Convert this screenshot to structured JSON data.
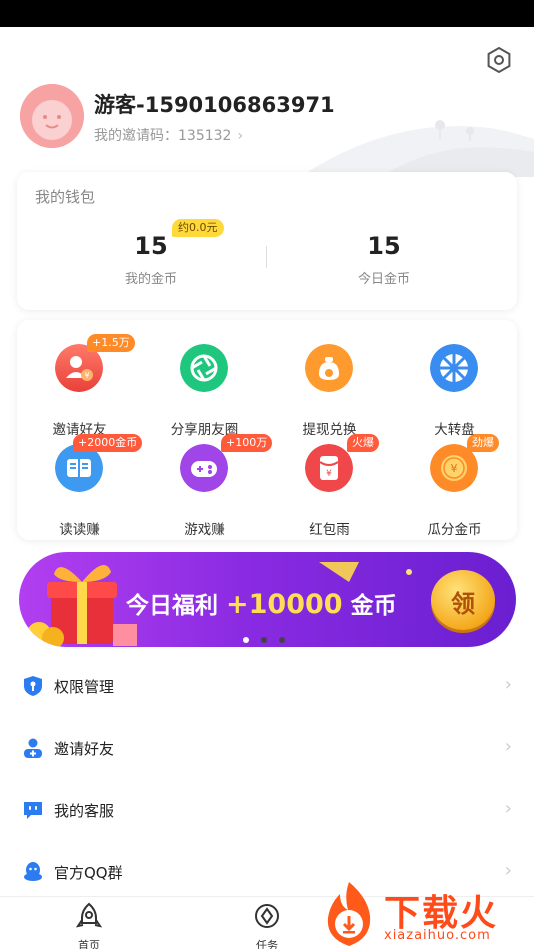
{
  "profile": {
    "username": "游客-1590106863971",
    "invite_code_label": "我的邀请码：135132",
    "chevron": "›"
  },
  "wallet": {
    "title": "我的钱包",
    "approx_badge": "约0.0元",
    "my_coins_value": "15",
    "my_coins_label": "我的金币",
    "today_coins_value": "15",
    "today_coins_label": "今日金币"
  },
  "grid": [
    {
      "label": "邀请好友",
      "badge": "+1.5万",
      "icon": "invite-friend-icon",
      "color": "#f25a4a"
    },
    {
      "label": "分享朋友圈",
      "badge": "",
      "icon": "moments-aperture-icon",
      "color": "#1ec77d"
    },
    {
      "label": "提现兑换",
      "badge": "",
      "icon": "money-bag-icon",
      "color": "#ff9a2e"
    },
    {
      "label": "大转盘",
      "badge": "",
      "icon": "wheel-icon",
      "color": "#3a8df0"
    },
    {
      "label": "读读赚",
      "badge": "+2000金币",
      "icon": "book-icon",
      "color": "#3d9af0"
    },
    {
      "label": "游戏赚",
      "badge": "+100万",
      "icon": "gamepad-icon",
      "color": "#a046e8"
    },
    {
      "label": "红包雨",
      "badge": "火爆",
      "icon": "red-envelope-icon",
      "color": "#f0484a"
    },
    {
      "label": "瓜分金币",
      "badge": "劲爆",
      "icon": "coin-icon",
      "color": "#ff8a28"
    }
  ],
  "banner": {
    "text_prefix": "今日福利",
    "text_amount": "+10000",
    "text_suffix": "金币",
    "button": "领"
  },
  "menu": [
    {
      "label": "权限管理",
      "icon": "shield-icon",
      "chevron": "›"
    },
    {
      "label": "邀请好友",
      "icon": "add-user-icon",
      "chevron": "›"
    },
    {
      "label": "我的客服",
      "icon": "chat-bubble-icon",
      "chevron": "›"
    },
    {
      "label": "官方QQ群",
      "icon": "qq-penguin-icon",
      "chevron": "›"
    }
  ],
  "tabbar": {
    "home_label": "首页",
    "task_label": "任务"
  },
  "watermark": {
    "text": "下载火",
    "sub": "xiazaihuo.com"
  },
  "colors": {
    "accent_blue": "#2b7cf0",
    "badge_red": "#ff5a3c",
    "badge_yellow": "#ffd93a",
    "banner_purple": "#8a2be2"
  }
}
